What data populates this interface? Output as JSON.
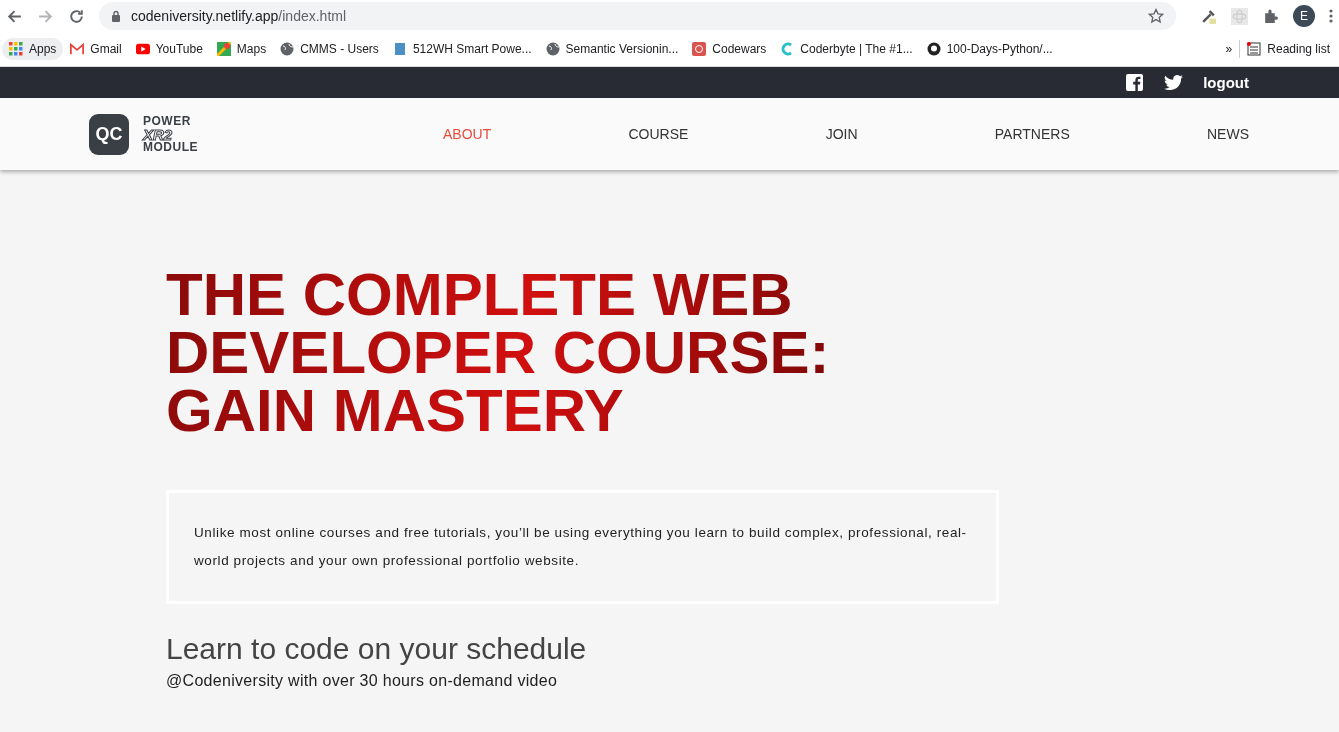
{
  "browser": {
    "url_host": "codeniversity.netlify.app",
    "url_path": "/index.html",
    "profile": "E",
    "bookmarks": [
      {
        "label": "Apps",
        "kind": "apps"
      },
      {
        "label": "Gmail",
        "kind": "gmail"
      },
      {
        "label": "YouTube",
        "kind": "youtube"
      },
      {
        "label": "Maps",
        "kind": "maps"
      },
      {
        "label": "CMMS - Users",
        "kind": "globe"
      },
      {
        "label": "512WH Smart Powe...",
        "kind": "doc"
      },
      {
        "label": "Semantic Versionin...",
        "kind": "globe"
      },
      {
        "label": "Codewars",
        "kind": "codewars"
      },
      {
        "label": "Coderbyte | The #1...",
        "kind": "coderbyte"
      },
      {
        "label": "100-Days-Python/...",
        "kind": "github"
      }
    ],
    "overflow": "»",
    "reading_list": "Reading list"
  },
  "topbar": {
    "logout": "logout"
  },
  "logo": {
    "badge": "QC",
    "line_1": "POWER",
    "line_2": "XR2",
    "line_3": "MODULE"
  },
  "nav": [
    {
      "label": "ABOUT",
      "selected": true
    },
    {
      "label": "COURSE",
      "selected": false
    },
    {
      "label": "JOIN",
      "selected": false
    },
    {
      "label": "PARTNERS",
      "selected": false
    },
    {
      "label": "NEWS",
      "selected": false
    }
  ],
  "hero": {
    "title": "THE COMPLETE WEB DEVELOPER COURSE: GAIN MASTERY",
    "intro": "Unlike most online courses and free tutorials, you’ll be using everything you learn to build complex, professional, real-world projects and your own professional portfolio website.",
    "subtitle": "Learn to code on your schedule",
    "tagline": "@Codeniversity with over 30 hours on-demand video"
  }
}
